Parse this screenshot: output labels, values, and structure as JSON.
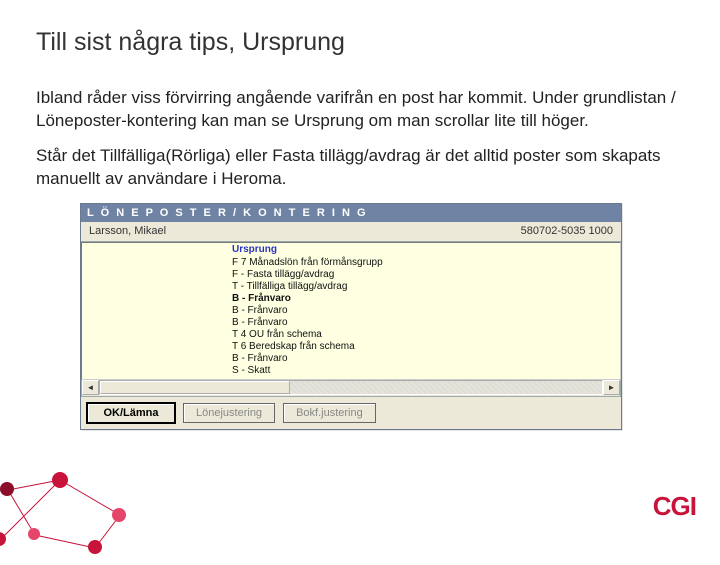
{
  "title": "Till sist några tips, Ursprung",
  "para1": "Ibland råder viss förvirring angående varifrån en post har kommit. Under grundlistan / Löneposter-kontering kan man se Ursprung om man scrollar lite till höger.",
  "para2": "Står det Tillfälliga(Rörliga) eller Fasta tillägg/avdrag är det alltid poster som skapats manuellt av användare i Heroma.",
  "app": {
    "header": "L Ö N E P O S T E R / K O N T E R I N G",
    "person": "Larsson, Mikael",
    "idnum": "580702-5035  1000",
    "colhead": "Ursprung",
    "rows": [
      {
        "text": "F 7 Månadslön från förmånsgrupp",
        "bold": false
      },
      {
        "text": "F - Fasta tillägg/avdrag",
        "bold": false
      },
      {
        "text": "T - Tillfälliga tillägg/avdrag",
        "bold": false
      },
      {
        "text": "B - Frånvaro",
        "bold": true
      },
      {
        "text": "B - Frånvaro",
        "bold": false
      },
      {
        "text": "B - Frånvaro",
        "bold": false
      },
      {
        "text": "T 4 OU från schema",
        "bold": false
      },
      {
        "text": "T 6 Beredskap från schema",
        "bold": false
      },
      {
        "text": "B - Frånvaro",
        "bold": false
      },
      {
        "text": "S - Skatt",
        "bold": false
      }
    ],
    "buttons": {
      "ok": "OK/Lämna",
      "loneadj": "Lönejustering",
      "bokadj": "Bokf.justering"
    }
  },
  "brand": "CGI"
}
